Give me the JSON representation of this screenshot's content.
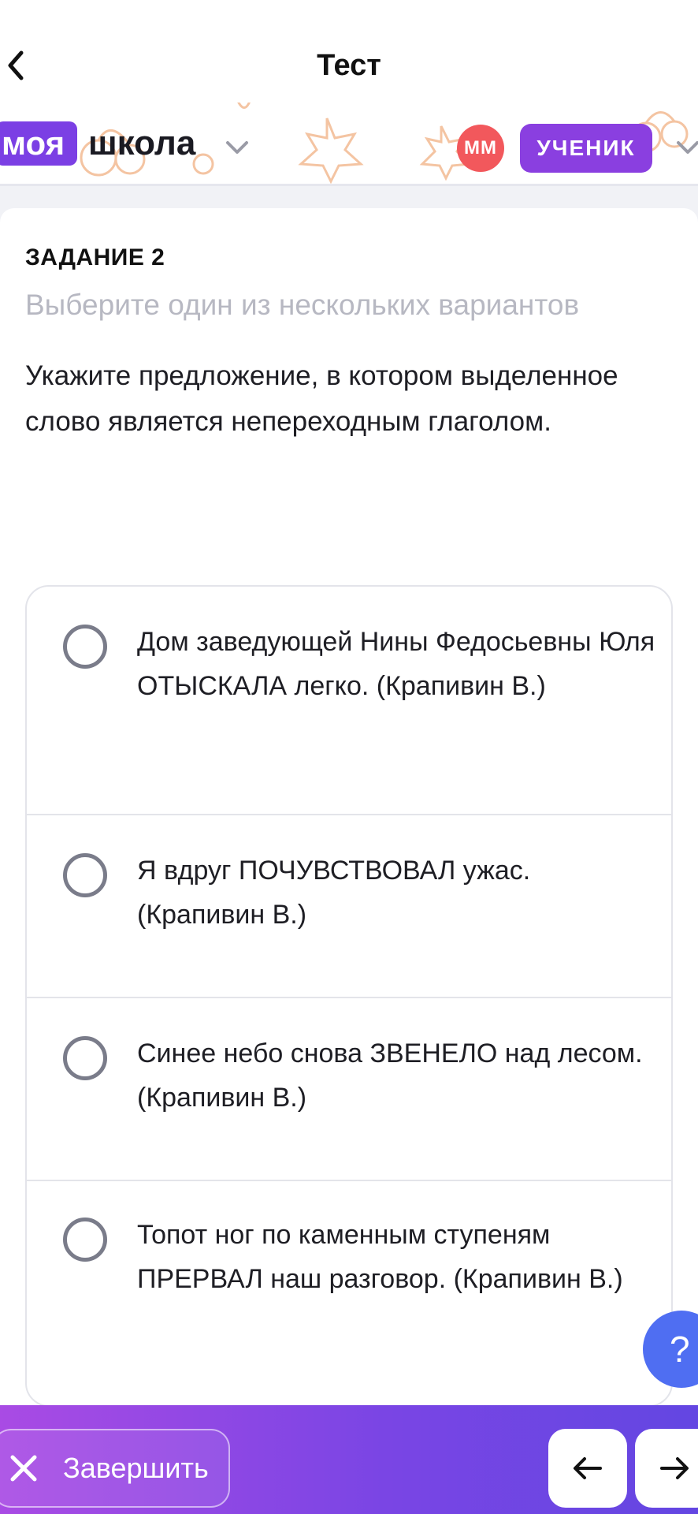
{
  "header": {
    "title": "Тест"
  },
  "school": {
    "logo_box": "моя",
    "logo_text": "школа",
    "avatar_initials": "ММ",
    "role": "УЧЕНИК"
  },
  "task": {
    "number": "ЗАДАНИЕ 2",
    "hint": "Выберите один из нескольких вариантов",
    "question": "Укажите предложение, в котором выделенное слово является непереходным глаголом.",
    "options": [
      {
        "text": "Дом заведующей Нины Федосьевны Юля ОТЫСКАЛА легко. (Крапивин В.)",
        "selected": false
      },
      {
        "text": "Я вдруг ПОЧУВСТВОВАЛ ужас. (Крапивин В.)",
        "selected": false
      },
      {
        "text": "Синее небо снова ЗВЕНЕЛО над лесом. (Крапивин В.)",
        "selected": false
      },
      {
        "text": "Топот ног по каменным ступеням ПРЕРВАЛ наш разговор. (Крапивин В.)",
        "selected": false
      }
    ]
  },
  "help": {
    "label": "?"
  },
  "footer": {
    "finish_label": "Завершить",
    "prev_icon": "arrow-left-icon",
    "next_icon": "arrow-right-icon"
  },
  "colors": {
    "brand_purple": "#7b3fe4",
    "avatar_red": "#f2585c",
    "help_blue": "#4f6ef2",
    "decor_orange": "#f4b48a"
  }
}
